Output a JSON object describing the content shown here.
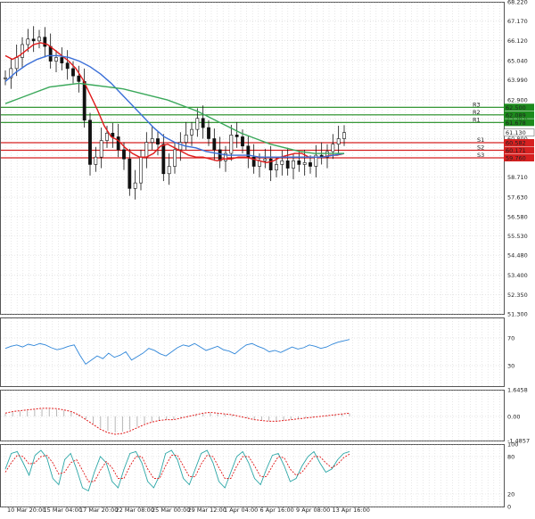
{
  "chart_data": [
    {
      "type": "candlestick",
      "panel": "price",
      "title": "",
      "ylim": [
        51.3,
        68.22
      ],
      "y_ticks": [
        "68.220",
        "67.170",
        "66.120",
        "65.040",
        "63.990",
        "62.900",
        "61.850",
        "60.800",
        "59.760",
        "58.710",
        "57.630",
        "56.580",
        "55.530",
        "54.480",
        "53.400",
        "52.350",
        "51.300"
      ],
      "x_ticks": [
        "10 Mar 20:00",
        "15 Mar 04:00",
        "17 Mar 20:00",
        "22 Mar 08:00",
        "25 Mar 00:00",
        "29 Mar 12:00",
        "1 Apr 04:00",
        "6 Apr 16:00",
        "9 Apr 08:00",
        "13 Apr 16:00"
      ],
      "current_price": "61.130",
      "levels": [
        {
          "label": "R3",
          "value": 62.5,
          "tag": "62.500",
          "color": "#1c8a1c"
        },
        {
          "label": "R2",
          "value": 62.089,
          "tag": "62.089",
          "color": "#1c8a1c"
        },
        {
          "label": "R1",
          "value": 61.678,
          "tag": "61.678",
          "color": "#1c8a1c"
        },
        {
          "label": "S1",
          "value": 60.582,
          "tag": "60.582",
          "color": "#d62020"
        },
        {
          "label": "S2",
          "value": 60.171,
          "tag": "60.171",
          "color": "#d62020"
        },
        {
          "label": "S3",
          "value": 59.76,
          "tag": "59.760",
          "color": "#d62020"
        }
      ],
      "series": [
        {
          "role": "price",
          "values": [
            64.1,
            64.6,
            65.2,
            65.9,
            66.2,
            66.1,
            66.3,
            65.8,
            65.0,
            65.2,
            64.9,
            64.6,
            64.2,
            63.9,
            61.8,
            59.4,
            59.8,
            60.7,
            61.1,
            60.9,
            60.2,
            59.7,
            58.1,
            58.4,
            59.8,
            60.6,
            60.8,
            60.5,
            58.9,
            59.3,
            60.2,
            60.6,
            61.0,
            61.3,
            61.9,
            61.4,
            60.8,
            60.2,
            59.6,
            60.0,
            61.0,
            60.9,
            60.4,
            59.8,
            59.3,
            59.6,
            59.7,
            59.1,
            59.4,
            59.6,
            59.2,
            59.6,
            59.4,
            59.5,
            59.3,
            59.9,
            59.8,
            60.1,
            60.5,
            60.8,
            61.13
          ]
        },
        {
          "role": "ma-fast",
          "color": "#e01a1a",
          "values": [
            65.3,
            65.1,
            65.3,
            65.6,
            65.9,
            66.0,
            65.9,
            65.6,
            65.3,
            65.0,
            64.6,
            64.0,
            63.2,
            62.4,
            61.5,
            60.9,
            60.7,
            60.3,
            60.0,
            59.8,
            59.8,
            60.0,
            60.4,
            60.5,
            60.3,
            60.1,
            59.9,
            59.8,
            59.8,
            59.7,
            59.6,
            59.7,
            59.7,
            59.8,
            59.8,
            59.7,
            59.6,
            59.5,
            59.6,
            59.8,
            59.9,
            60.0,
            60.0,
            59.8,
            59.8,
            59.8,
            59.9,
            59.9,
            60.0
          ]
        },
        {
          "role": "ma-mid",
          "color": "#3a6fd8",
          "values": [
            63.9,
            64.4,
            64.8,
            65.1,
            65.3,
            65.3,
            65.2,
            65.0,
            64.7,
            64.3,
            63.8,
            63.2,
            62.6,
            62.0,
            61.4,
            60.9,
            60.6,
            60.4,
            60.3,
            60.1,
            60.0,
            59.9,
            59.9,
            59.9,
            59.8,
            59.8,
            59.8,
            59.8,
            59.8,
            59.8,
            59.8,
            59.9,
            60.0
          ]
        },
        {
          "role": "ma-slow",
          "color": "#3aa85a",
          "values": [
            62.7,
            63.0,
            63.3,
            63.6,
            63.7,
            63.8,
            63.7,
            63.6,
            63.5,
            63.3,
            63.1,
            62.9,
            62.6,
            62.3,
            61.9,
            61.5,
            61.1,
            60.8,
            60.5,
            60.3,
            60.1,
            60.0,
            60.0,
            60.0
          ]
        }
      ]
    },
    {
      "type": "line",
      "panel": "oscillator-1",
      "title": "",
      "ylim": [
        0,
        100
      ],
      "y_ticks": [
        "70",
        "30"
      ],
      "series": [
        {
          "role": "oscillator",
          "color": "#2f86d9",
          "values": [
            55,
            58,
            60,
            57,
            61,
            59,
            62,
            60,
            56,
            53,
            55,
            58,
            60,
            45,
            32,
            38,
            44,
            40,
            48,
            42,
            45,
            50,
            38,
            43,
            48,
            55,
            52,
            47,
            44,
            50,
            56,
            60,
            58,
            62,
            57,
            52,
            55,
            58,
            53,
            51,
            47,
            54,
            60,
            62,
            58,
            55,
            50,
            52,
            49,
            53,
            57,
            54,
            56,
            60,
            58,
            55,
            57,
            61,
            64,
            66,
            68
          ]
        }
      ]
    },
    {
      "type": "line",
      "panel": "oscillator-2",
      "title": "",
      "ylim": [
        -1.4857,
        1.6458
      ],
      "y_ticks": [
        "1.6458",
        "0.00",
        "-1.4857"
      ],
      "series": [
        {
          "role": "signal",
          "color": "#e01a1a",
          "values": [
            0.2,
            0.3,
            0.35,
            0.4,
            0.45,
            0.5,
            0.5,
            0.48,
            0.4,
            0.3,
            0.1,
            -0.2,
            -0.5,
            -0.8,
            -1.0,
            -1.1,
            -1.05,
            -0.9,
            -0.7,
            -0.5,
            -0.35,
            -0.25,
            -0.2,
            -0.2,
            -0.1,
            0.0,
            0.1,
            0.2,
            0.25,
            0.2,
            0.15,
            0.1,
            0.0,
            -0.1,
            -0.2,
            -0.25,
            -0.3,
            -0.3,
            -0.25,
            -0.2,
            -0.15,
            -0.1,
            -0.05,
            0.0,
            0.05,
            0.1,
            0.15,
            0.2
          ]
        }
      ]
    },
    {
      "type": "line",
      "panel": "oscillator-3",
      "title": "",
      "ylim": [
        0,
        100
      ],
      "y_ticks": [
        "100",
        "80",
        "20",
        "0"
      ],
      "series": [
        {
          "role": "main",
          "color": "#2aa6a6",
          "values": [
            60,
            85,
            88,
            70,
            50,
            82,
            90,
            78,
            45,
            35,
            75,
            85,
            60,
            30,
            25,
            55,
            80,
            70,
            40,
            30,
            60,
            85,
            88,
            70,
            40,
            30,
            50,
            85,
            90,
            75,
            45,
            35,
            60,
            85,
            90,
            70,
            40,
            30,
            55,
            80,
            88,
            70,
            45,
            35,
            60,
            82,
            85,
            65,
            40,
            45,
            65,
            80,
            88,
            70,
            55,
            60,
            75,
            85,
            88
          ]
        },
        {
          "role": "signal",
          "color": "#e01a1a",
          "values": [
            55,
            70,
            82,
            80,
            68,
            70,
            80,
            82,
            70,
            52,
            55,
            70,
            75,
            58,
            40,
            40,
            58,
            72,
            62,
            45,
            45,
            65,
            80,
            80,
            60,
            45,
            45,
            65,
            82,
            82,
            65,
            48,
            48,
            68,
            82,
            80,
            62,
            45,
            45,
            65,
            80,
            80,
            65,
            48,
            48,
            65,
            80,
            78,
            60,
            50,
            55,
            68,
            80,
            80,
            70,
            62,
            68,
            78,
            84
          ]
        }
      ]
    }
  ]
}
